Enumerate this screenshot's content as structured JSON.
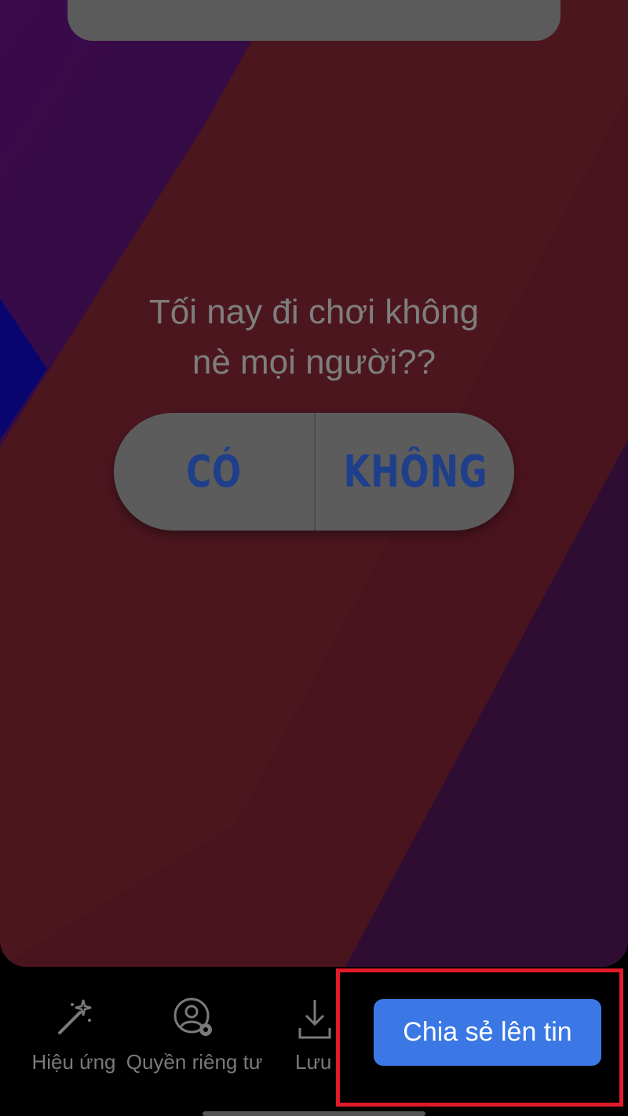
{
  "story": {
    "question_line1": "Tối nay đi chơi không",
    "question_line2": "nè mọi người??",
    "poll": {
      "option_left": "CÓ",
      "option_right": "KHÔNG"
    }
  },
  "palette": {
    "swatches": [
      "#8b1e26",
      "#4e4e55",
      "#6a4a5c",
      "#1e5e97",
      "#7a4a62",
      "#7a6a22"
    ]
  },
  "toolbar": {
    "effects_label": "Hiệu ứng",
    "privacy_label": "Quyền riêng tư",
    "save_label": "Lưu",
    "share_label": "Chia sẻ lên tin"
  },
  "colors": {
    "share_button": "#3b78e6",
    "highlight": "#e11b2a"
  }
}
